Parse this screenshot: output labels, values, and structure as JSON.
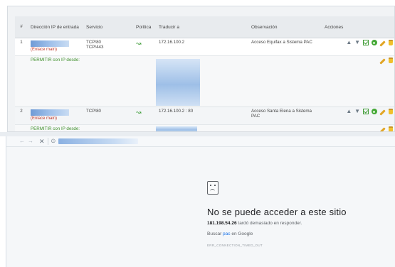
{
  "table": {
    "headers": {
      "num": "#",
      "ip": "Dirección IP de entrada",
      "service": "Servicio",
      "policy": "Política",
      "translate": "Traducir a",
      "observation": "Observación",
      "actions": "Acciones"
    },
    "rules": [
      {
        "num": "1",
        "ip_label": "(Enlace main)",
        "service_1": "TCP/80",
        "service_2": "TCP/443",
        "translate": "172.16.100.2",
        "observation": "Acceso Equifax a Sistema PAC",
        "permit_label": "PERMITIR con IP desde:"
      },
      {
        "num": "2",
        "ip_label": "(Enlace main)",
        "service_1": "TCP/80",
        "service_2": "",
        "translate": "172.16.100.2 : 80",
        "observation": "Acceso Santa Elena a Sistema PAC",
        "permit_label": "PERMITIR con IP desde:"
      }
    ]
  },
  "browser": {
    "error_title": "No se puede acceder a este sitio",
    "error_host": "181.198.54.26",
    "error_message": " tardó demasiado en responder.",
    "search_prefix": "Buscar ",
    "search_term": "pac",
    "search_suffix": " en Google",
    "error_code": "ERR_CONNECTION_TIMED_OUT"
  },
  "icons": {
    "policy": "policy-allow-icon",
    "move_up": "arrow-up-icon",
    "move_down": "arrow-down-icon",
    "check": "checkbox-icon",
    "enable": "enable-icon",
    "edit": "pencil-icon",
    "delete": "trash-icon",
    "back": "back-arrow-icon",
    "forward": "forward-arrow-icon",
    "stop": "stop-icon",
    "view": "view-icon",
    "sad_page": "sad-page-icon"
  },
  "colors": {
    "permit_text": "#3e8f2a",
    "ip_label": "#c0392b",
    "link": "#1a73e8"
  }
}
